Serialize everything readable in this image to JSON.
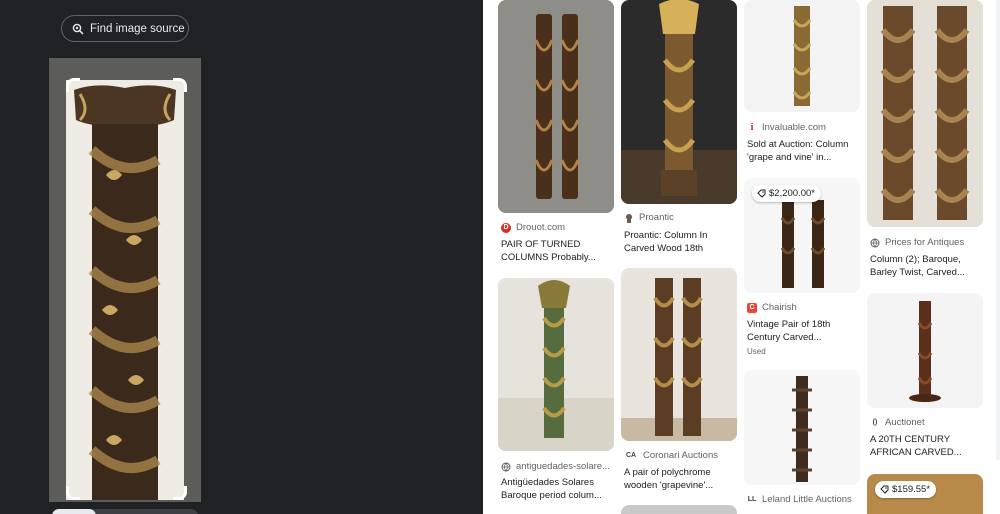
{
  "lens": {
    "find_source_label": "Find image source"
  },
  "results": [
    {
      "id": "drouot",
      "source": "Drouot.com",
      "logo_letter": "D",
      "logo_color": "#d93025",
      "title": "PAIR OF TURNED COLUMNS Probably..."
    },
    {
      "id": "proantic",
      "source": "Proantic",
      "logo_letter": "P",
      "logo_color": "#6d5a4a",
      "title": "Proantic: Column In Carved Wood 18th"
    },
    {
      "id": "invaluable",
      "source": "Invaluable.com",
      "logo_letter": "i",
      "logo_color": "#c5221f",
      "title": "Sold at Auction: Column 'grape and vine' in..."
    },
    {
      "id": "prices-antiques",
      "source": "Prices for Antiques",
      "logo_letter": "",
      "logo_color": "#5f6368",
      "title": "Column (2); Baroque, Barley Twist, Carved..."
    },
    {
      "id": "antiguedades",
      "source": "antiguedades-solare...",
      "logo_letter": "",
      "logo_color": "#5f6368",
      "title": "Antigüedades Solares Baroque period colum..."
    },
    {
      "id": "coronari",
      "source": "Coronari Auctions",
      "logo_letter": "CA",
      "logo_color": "#3c4043",
      "title": "A pair of polychrome wooden 'grapevine'..."
    },
    {
      "id": "chairish",
      "source": "Chairish",
      "logo_letter": "C",
      "logo_color": "#e8453c",
      "title": "Vintage Pair of 18th Century Carved...",
      "subtitle": "Used",
      "price": "$2,200.00*"
    },
    {
      "id": "auctionet",
      "source": "Auctionet",
      "logo_letter": "()",
      "logo_color": "#3c4043",
      "title": "A 20TH CENTURY AFRICAN CARVED..."
    },
    {
      "id": "leland",
      "source": "Leland Little Auctions",
      "logo_letter": "LL",
      "logo_color": "#3c4043",
      "title": ""
    },
    {
      "id": "last",
      "source": "",
      "logo_letter": "",
      "logo_color": "#5f6368",
      "title": "",
      "price": "$159.55*"
    }
  ]
}
